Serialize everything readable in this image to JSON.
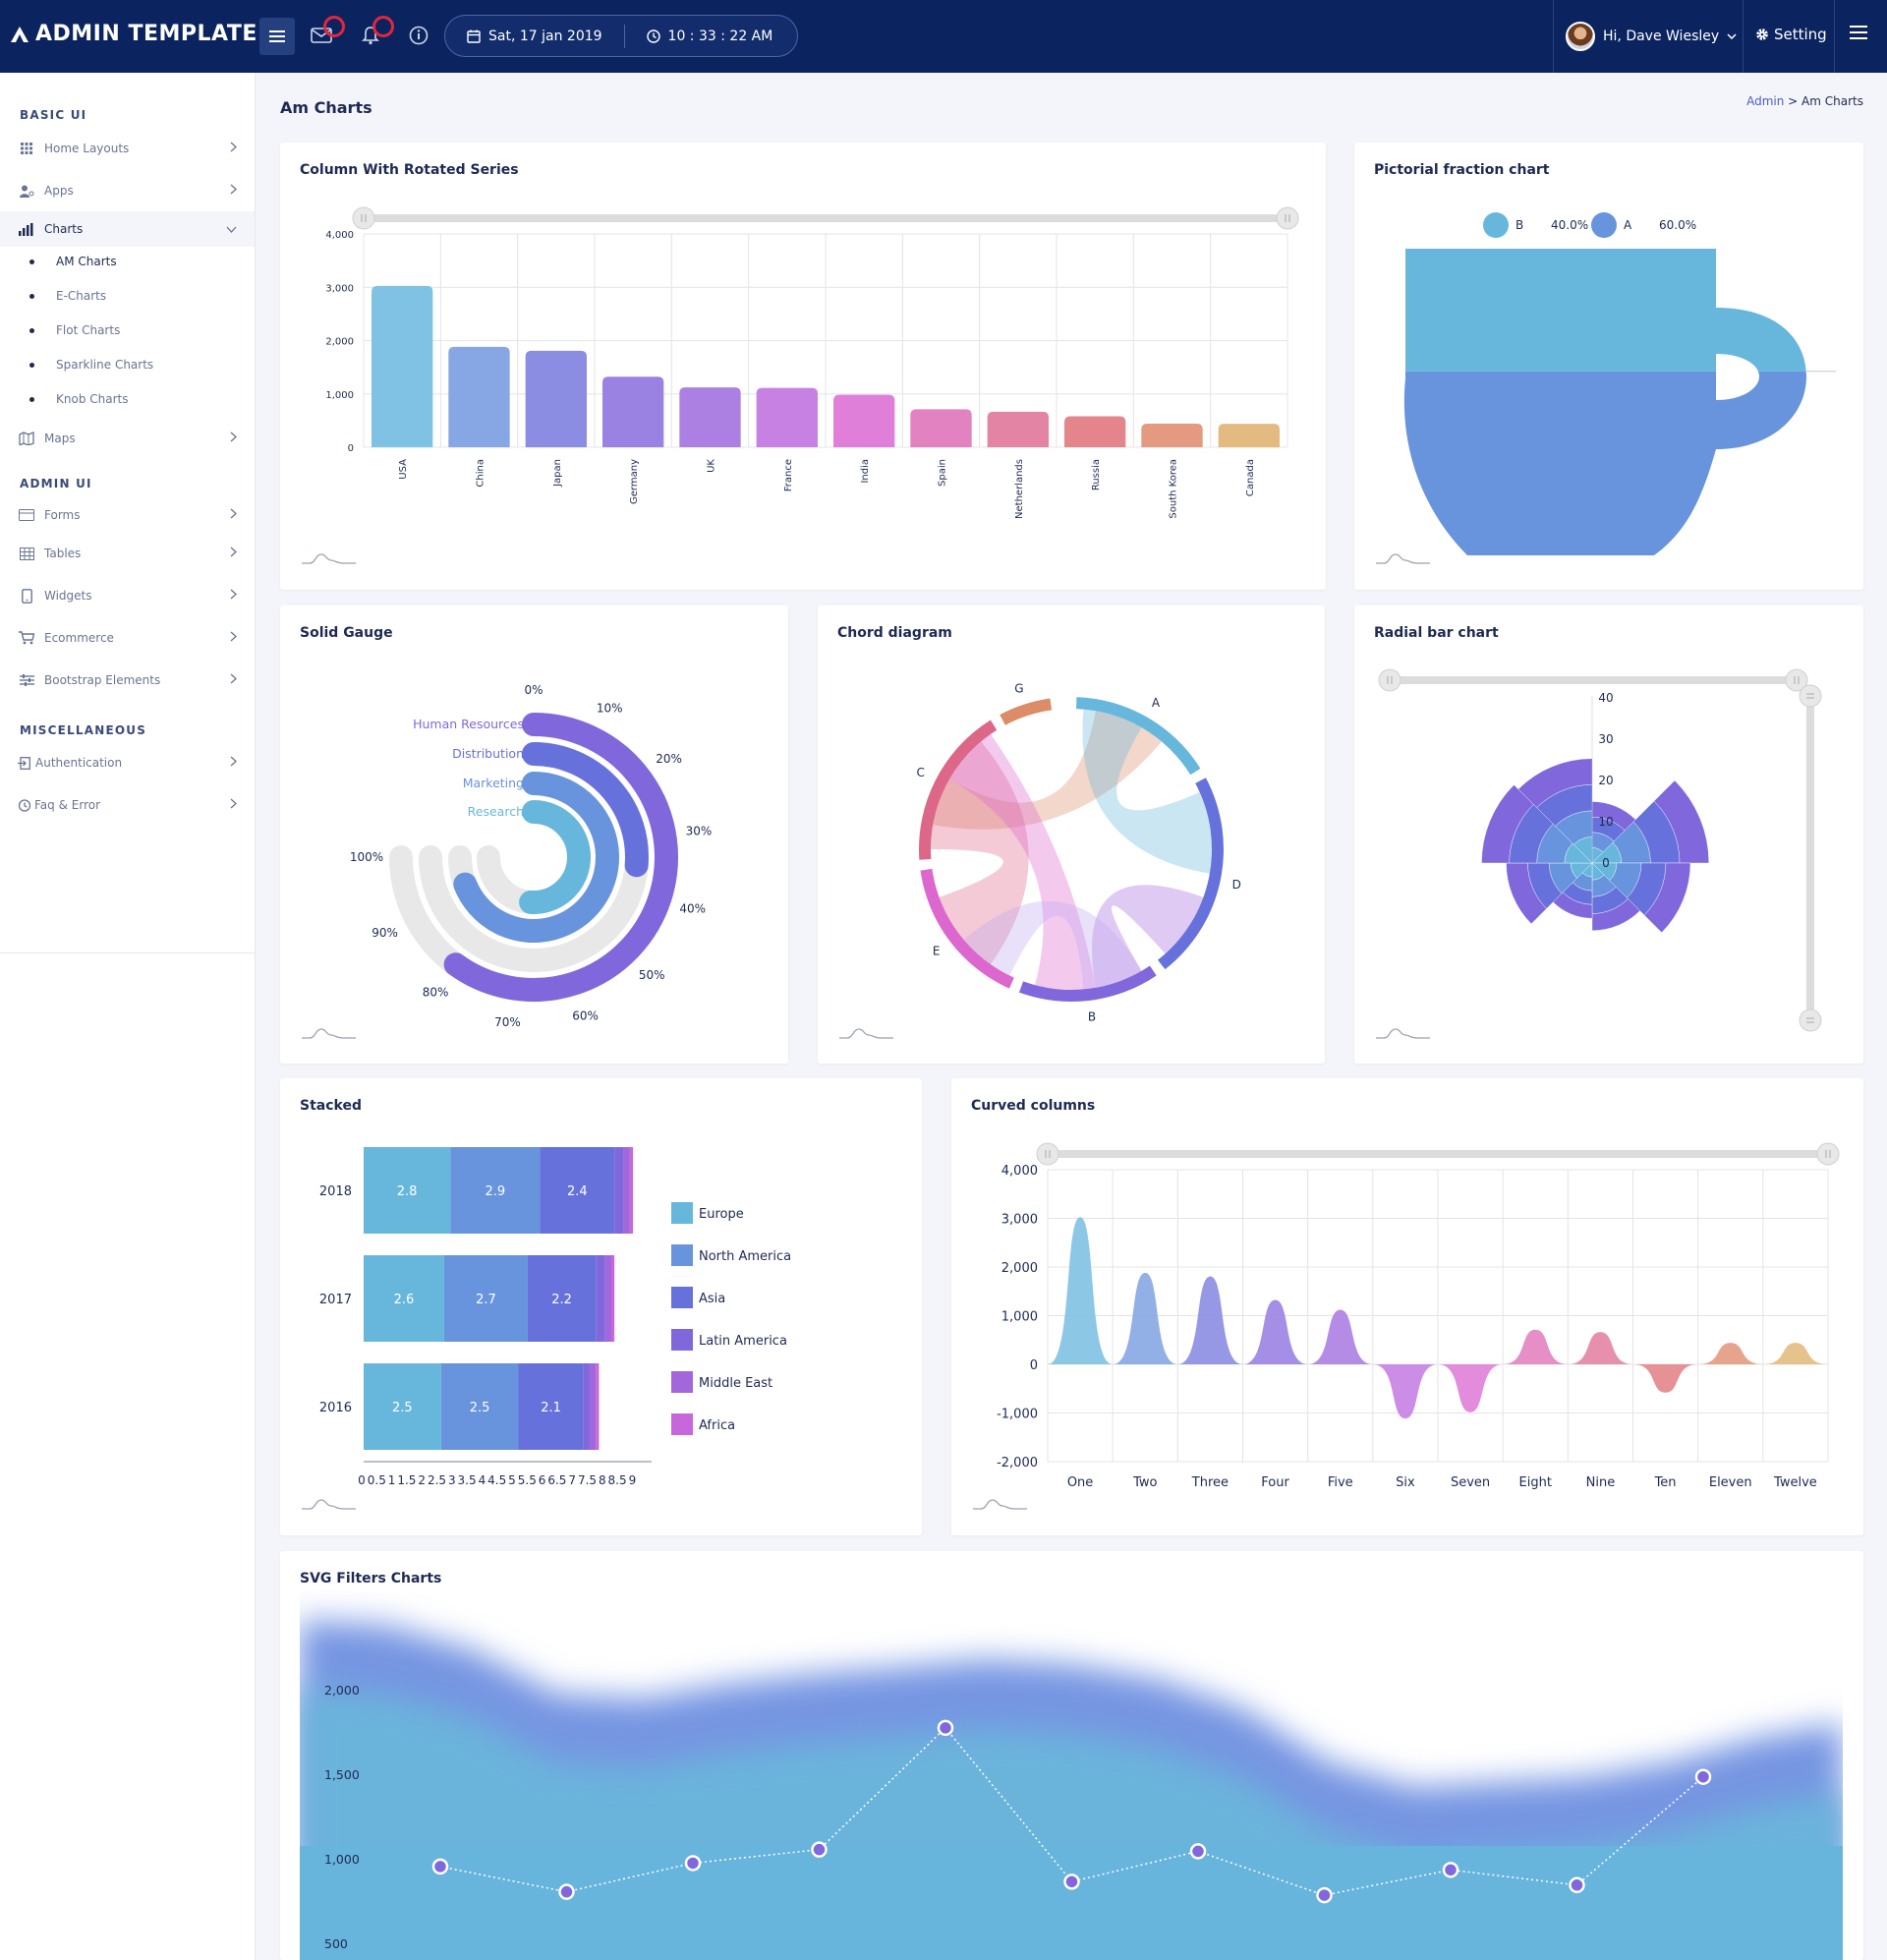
{
  "header": {
    "brand": "ADMIN TEMPLATE",
    "date": "Sat, 17 jan 2019",
    "time": "10 : 33 : 22 AM",
    "user": "Hi, Dave Wiesley",
    "setting": "Setting",
    "icons": [
      "menu-icon",
      "mail-icon",
      "bell-icon",
      "info-icon",
      "calendar-icon",
      "clock-icon",
      "chevron-down-icon",
      "gear-icon",
      "hamburger-icon"
    ]
  },
  "sidebar": {
    "basic_ui": "BASIC UI",
    "admin_ui": "ADMIN UI",
    "misc": "MISCELLANEOUS",
    "items": {
      "home_layouts": "Home Layouts",
      "apps": "Apps",
      "charts": "Charts",
      "maps": "Maps",
      "forms": "Forms",
      "tables": "Tables",
      "widgets": "Widgets",
      "ecommerce": "Ecommerce",
      "bootstrap": "Bootstrap Elements",
      "authentication": "Authentication",
      "faq": "Faq & Error"
    },
    "chart_subs": [
      "AM Charts",
      "E-Charts",
      "Flot Charts",
      "Sparkline Charts",
      "Knob Charts"
    ]
  },
  "page": {
    "title": "Am Charts",
    "breadcrumb_admin": "Admin",
    "breadcrumb_sep": " > ",
    "breadcrumb_current": "Am Charts"
  },
  "cards": {
    "rotated": "Column With Rotated Series",
    "pictorial": "Pictorial fraction chart",
    "gauge": "Solid Gauge",
    "chord": "Chord diagram",
    "radial": "Radial bar chart",
    "stacked": "Stacked",
    "curved": "Curved columns",
    "svgfilter": "SVG Filters Charts"
  },
  "colors": {
    "topbar": "#0b2460",
    "accent": "#4a5fc1",
    "background": "#f4f5fa"
  },
  "chart_data": [
    {
      "id": "rotated",
      "type": "bar",
      "categories": [
        "USA",
        "China",
        "Japan",
        "Germany",
        "UK",
        "France",
        "India",
        "Spain",
        "Netherlands",
        "Russia",
        "South Korea",
        "Canada"
      ],
      "values": [
        3025,
        1882,
        1809,
        1322,
        1122,
        1114,
        984,
        711,
        665,
        580,
        443,
        441
      ],
      "ylim": [
        0,
        4000
      ],
      "yticks": [
        "0",
        "1,000",
        "2,000",
        "3,000",
        "4,000"
      ],
      "colors": [
        "#80c2e3",
        "#86a7e3",
        "#8b8de3",
        "#9a82e3",
        "#ac80e3",
        "#c781e3",
        "#e07fd9",
        "#e382c0",
        "#e384a4",
        "#e3858a",
        "#e39a80",
        "#e3bb80"
      ]
    },
    {
      "id": "pictorial",
      "type": "pictorial",
      "series": [
        {
          "name": "B",
          "value_label": "40.0%",
          "value": 40,
          "color": "#67b7dc"
        },
        {
          "name": "A",
          "value_label": "60.0%",
          "value": 60,
          "color": "#6794dc"
        }
      ]
    },
    {
      "id": "gauge",
      "type": "radial",
      "categories": [
        "Human Resources",
        "Distribution",
        "Marketing",
        "Research"
      ],
      "values": [
        80,
        35,
        92,
        68
      ],
      "colors": [
        "#8067dc",
        "#6771dc",
        "#6794dc",
        "#67b7dc"
      ],
      "ticks": [
        "0%",
        "10%",
        "20%",
        "30%",
        "40%",
        "50%",
        "60%",
        "70%",
        "80%",
        "90%",
        "100%"
      ]
    },
    {
      "id": "chord",
      "type": "chord",
      "nodes": [
        "A",
        "B",
        "C",
        "D",
        "E",
        "G"
      ]
    },
    {
      "id": "radial",
      "type": "radial",
      "ticks": [
        "0",
        "10",
        "20",
        "30",
        "40"
      ]
    },
    {
      "id": "stacked",
      "type": "bar",
      "categories": [
        "2018",
        "2017",
        "2016"
      ],
      "series": [
        {
          "name": "Europe",
          "values": [
            2.8,
            2.6,
            2.5
          ],
          "color": "#67b7dc"
        },
        {
          "name": "North America",
          "values": [
            2.9,
            2.7,
            2.5
          ],
          "color": "#6794dc"
        },
        {
          "name": "Asia",
          "values": [
            2.4,
            2.2,
            2.1
          ],
          "color": "#6771dc"
        },
        {
          "name": "Latin America",
          "values": [
            0.3,
            0.3,
            0.2
          ],
          "color": "#8067dc"
        },
        {
          "name": "Middle East",
          "values": [
            0.2,
            0.2,
            0.2
          ],
          "color": "#a367dc"
        },
        {
          "name": "Africa",
          "values": [
            0.1,
            0.1,
            0.1
          ],
          "color": "#c767dc"
        }
      ],
      "xticks": [
        "0",
        "0.5",
        "1",
        "1.5",
        "2",
        "2.5",
        "3",
        "3.5",
        "4",
        "4.5",
        "5",
        "5.5",
        "6",
        "6.5",
        "7",
        "7.5",
        "8",
        "8.5",
        "9"
      ]
    },
    {
      "id": "curved",
      "type": "bar",
      "categories": [
        "One",
        "Two",
        "Three",
        "Four",
        "Five",
        "Six",
        "Seven",
        "Eight",
        "Nine",
        "Ten",
        "Eleven",
        "Twelve"
      ],
      "values": [
        3025,
        1882,
        1809,
        1322,
        1122,
        -1114,
        -984,
        711,
        665,
        -580,
        443,
        441
      ],
      "ylim": [
        -2000,
        4000
      ],
      "yticks": [
        "-2,000",
        "-1,000",
        "0",
        "1,000",
        "2,000",
        "3,000",
        "4,000"
      ],
      "colors": [
        "#80c2e3",
        "#86a7e3",
        "#8b8de3",
        "#9a82e3",
        "#ac80e3",
        "#c781e3",
        "#e07fd9",
        "#e382c0",
        "#e384a4",
        "#e3858a",
        "#e39a80",
        "#e3bb80"
      ]
    },
    {
      "id": "svgfilter",
      "type": "line",
      "yticks": [
        "500",
        "1,000",
        "1,500",
        "2,000"
      ],
      "values": [
        960,
        810,
        980,
        1060,
        1780,
        870,
        1050,
        790,
        940,
        850,
        1490
      ]
    }
  ]
}
